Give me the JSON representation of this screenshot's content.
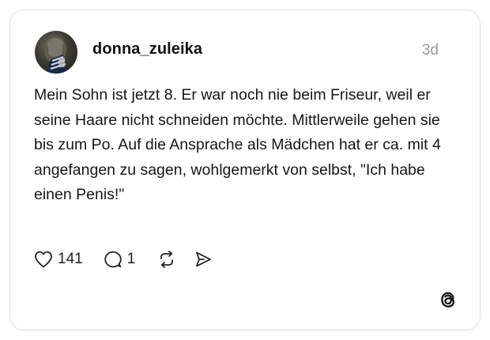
{
  "post": {
    "username": "donna_zuleika",
    "timestamp": "3d",
    "text": "Mein Sohn ist jetzt 8. Er war noch nie beim Friseur, weil er seine Haare nicht schneiden möchte. Mittlerweile gehen sie bis zum Po. Auf die Ansprache als Mädchen hat er ca. mit 4 angefangen zu sagen, wohlgemerkt von selbst, \"Ich habe einen Penis!\""
  },
  "actions": {
    "like_count": "141",
    "reply_count": "1"
  },
  "icons": {
    "like": "heart-icon",
    "reply": "comment-icon",
    "repost": "repost-icon",
    "share": "send-icon",
    "brand": "threads-logo-icon"
  }
}
